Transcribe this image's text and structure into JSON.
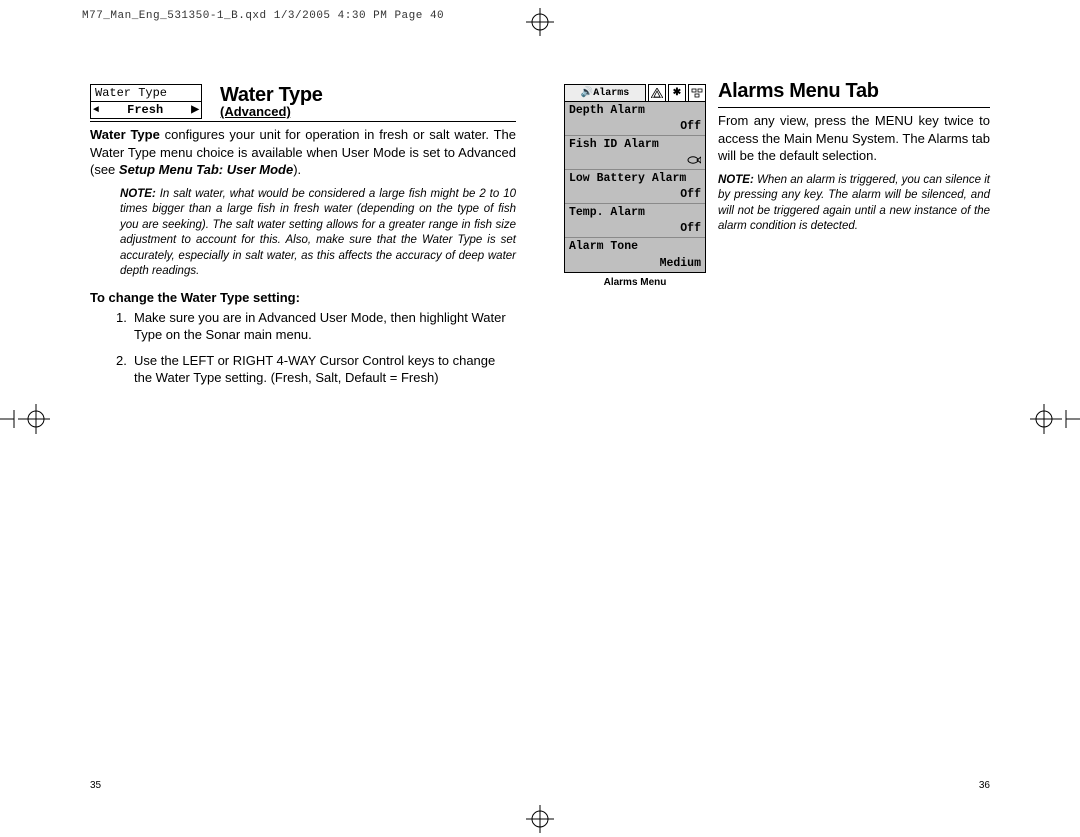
{
  "slug": "M77_Man_Eng_531350-1_B.qxd  1/3/2005  4:30 PM  Page 40",
  "left": {
    "page_number": "35",
    "widget": {
      "label": "Water Type",
      "value": "Fresh"
    },
    "heading": "Water Type",
    "subheading": "(Advanced)",
    "paragraph_lead": "Water Type",
    "paragraph_rest": " configures your unit for operation in fresh or salt water. The Water Type menu choice is available when User Mode is set to Advanced (see ",
    "paragraph_link": "Setup Menu Tab: User Mode",
    "paragraph_end": ").",
    "note_label": "NOTE:",
    "note_text": "  In salt water, what would be considered a large fish might be 2 to 10 times bigger than a large fish in fresh water (depending on the type of fish you are seeking).  The salt water setting allows for a greater range in fish size adjustment to account for this. Also, make sure that the Water Type is set accurately, especially in salt water, as this affects the accuracy of deep water depth readings.",
    "steps_heading": "To change the Water Type setting:",
    "steps": [
      "Make sure you are in Advanced User Mode, then highlight Water Type on the Sonar main menu.",
      "Use the LEFT or RIGHT 4-WAY Cursor Control keys to change the Water Type setting. (Fresh, Salt, Default = Fresh)"
    ]
  },
  "right": {
    "page_number": "36",
    "heading": "Alarms Menu Tab",
    "paragraph": "From any view, press the MENU key twice to access the Main Menu System. The Alarms tab will be the default selection.",
    "note_label": "NOTE:",
    "note_text": " When an alarm is triggered, you can silence it by pressing any key. The alarm will be silenced, and will not be triggered again until a new instance of the alarm condition is detected.",
    "alarms_caption": "Alarms Menu",
    "alarms_tab_label": "Alarms",
    "alarms_rows": [
      {
        "label": "Depth Alarm",
        "value": "Off"
      },
      {
        "label": "Fish ID Alarm",
        "value": ""
      },
      {
        "label": "Low Battery Alarm",
        "value": "Off"
      },
      {
        "label": "Temp. Alarm",
        "value": "Off"
      },
      {
        "label": "Alarm Tone",
        "value": "Medium"
      }
    ]
  }
}
